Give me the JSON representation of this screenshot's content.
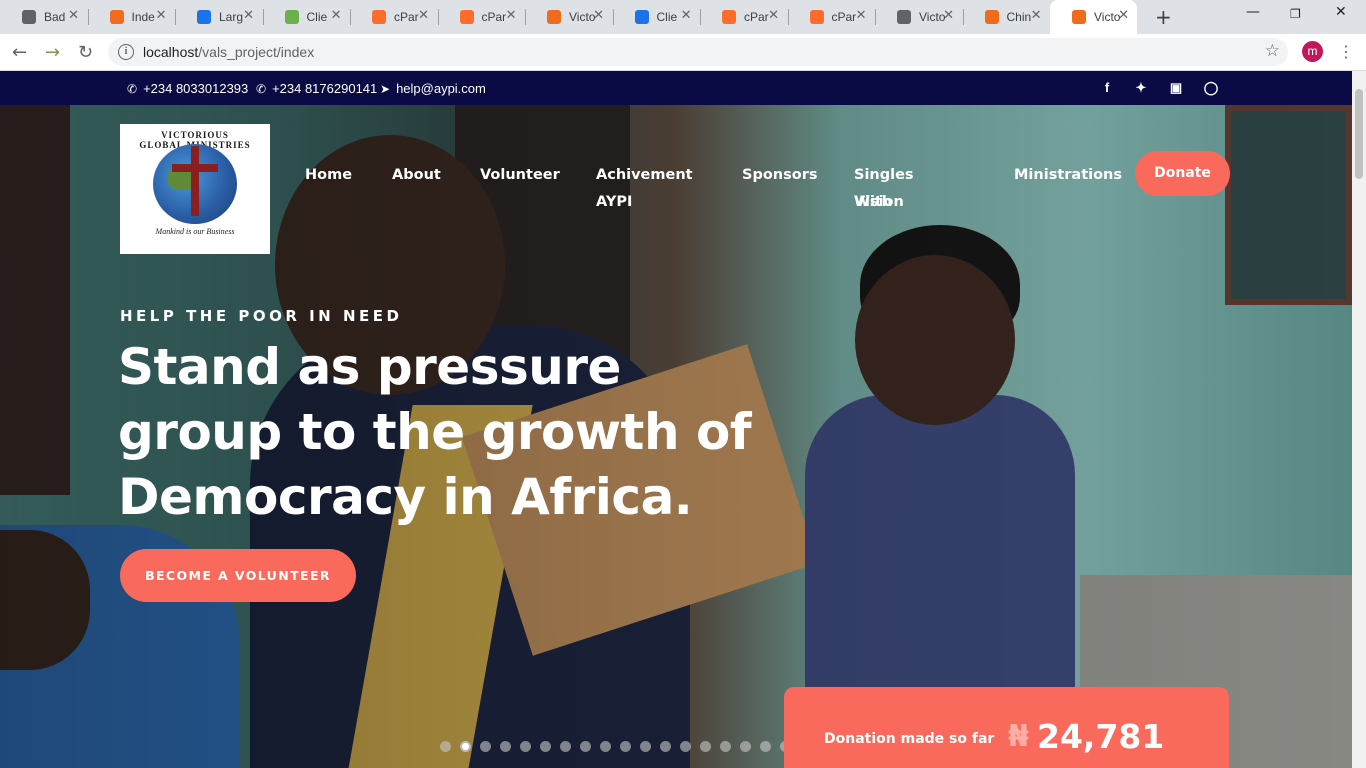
{
  "browser": {
    "tabs": [
      {
        "title": "Bad",
        "icon": "globe-icon",
        "color": "#5f6368"
      },
      {
        "title": "Inde",
        "icon": "xampp-icon",
        "color": "#f26b1d"
      },
      {
        "title": "Larg",
        "icon": "grid-icon",
        "color": "#1a73e8"
      },
      {
        "title": "Clie",
        "icon": "bars-icon",
        "color": "#6ab04c"
      },
      {
        "title": "cPar",
        "icon": "cpanel-icon",
        "color": "#ff6c2c"
      },
      {
        "title": "cPar",
        "icon": "cpanel-icon",
        "color": "#ff6c2c"
      },
      {
        "title": "Victo",
        "icon": "xampp-icon",
        "color": "#f26b1d"
      },
      {
        "title": "Clie",
        "icon": "client-icon",
        "color": "#1a73e8"
      },
      {
        "title": "cPar",
        "icon": "cpanel-icon",
        "color": "#ff6c2c"
      },
      {
        "title": "cPar",
        "icon": "cpanel-icon",
        "color": "#ff6c2c"
      },
      {
        "title": "Victo",
        "icon": "globe-icon",
        "color": "#5f6368"
      },
      {
        "title": "Chin",
        "icon": "xampp-icon",
        "color": "#f26b1d"
      },
      {
        "title": "Victo",
        "icon": "xampp-icon",
        "color": "#f26b1d",
        "active": true
      }
    ],
    "url_host": "localhost",
    "url_path": "/vals_project/index",
    "profile_initial": "m"
  },
  "topbar": {
    "phone1": "+234 8033012393",
    "phone2": "+234 8176290141",
    "email": "help@aypi.com",
    "social": [
      "facebook-icon",
      "twitter-icon",
      "instagram-icon",
      "dribbble-icon"
    ]
  },
  "logo": {
    "arc_text": "VICTORIOUS GLOBAL MINISTRIES",
    "tagline": "Mankind is our Business"
  },
  "nav": {
    "home": "Home",
    "about": "About",
    "volunteer": "Volunteer",
    "achievement_1": "Achivement",
    "achievement_2": "AYPI",
    "sponsors": "Sponsors",
    "singles_1": "Singles With",
    "singles_2": "Vision",
    "ministrations": "Ministrations",
    "donate": "Donate"
  },
  "hero": {
    "eyebrow": "HELP THE POOR IN NEED",
    "headline_1": "Stand as pressure",
    "headline_2": "group to the growth of",
    "headline_3": "Democracy in Africa.",
    "cta": "BECOME A VOLUNTEER",
    "slides_total": 18,
    "active_slide": 2
  },
  "donation": {
    "label": "Donation made so far",
    "currency": "₦",
    "amount": "24,781"
  },
  "colors": {
    "accent": "#f96a5c",
    "topbar": "#0a0a45"
  }
}
